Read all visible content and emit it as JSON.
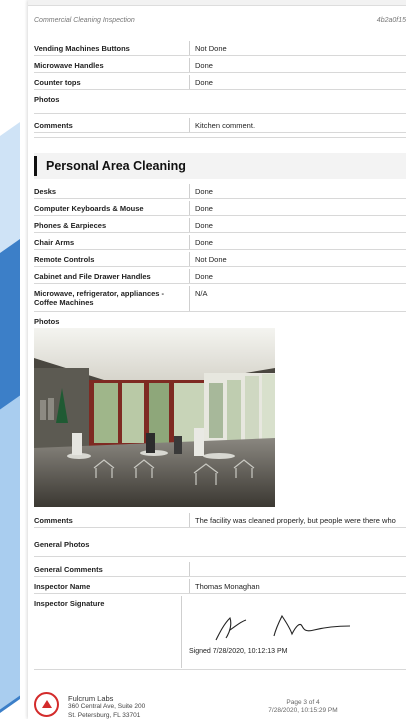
{
  "header": {
    "title": "Commercial Cleaning Inspection",
    "record_id": "4b2a0f15"
  },
  "kitchen": {
    "rows": [
      {
        "label": "Vending Machines Buttons",
        "value": "Not Done"
      },
      {
        "label": "Microwave Handles",
        "value": "Done"
      },
      {
        "label": "Counter tops",
        "value": "Done"
      }
    ],
    "photos_label": "Photos",
    "comments_label": "Comments",
    "comments_value": "Kitchen comment."
  },
  "personal": {
    "title": "Personal Area Cleaning",
    "rows": [
      {
        "label": "Desks",
        "value": "Done"
      },
      {
        "label": "Computer Keyboards & Mouse",
        "value": "Done"
      },
      {
        "label": "Phones & Earpieces",
        "value": "Done"
      },
      {
        "label": "Chair Arms",
        "value": "Done"
      },
      {
        "label": "Remote Controls",
        "value": "Not Done"
      },
      {
        "label": "Cabinet and File Drawer Handles",
        "value": "Done"
      }
    ],
    "microwave_label_1": "Microwave, refrigerator, appliances -",
    "microwave_label_2": "Coffee Machines",
    "microwave_value": "N/A",
    "photos_label": "Photos",
    "comments_label": "Comments",
    "comments_value": "The facility was cleaned properly, but people were there who"
  },
  "general": {
    "photos_label": "General Photos",
    "comments_label": "General Comments",
    "comments_value": "",
    "inspector_name_label": "Inspector Name",
    "inspector_name": "Thomas Monaghan",
    "signature_label": "Inspector Signature",
    "signed_text": "Signed 7/28/2020, 10:12:13 PM"
  },
  "footer": {
    "company": "Fulcrum Labs",
    "address_1": "360 Central Ave, Suite 200",
    "address_2": "St. Petersburg, FL 33701",
    "page": "Page 3 of 4",
    "generated": "7/28/2020, 10:15:29 PM"
  }
}
